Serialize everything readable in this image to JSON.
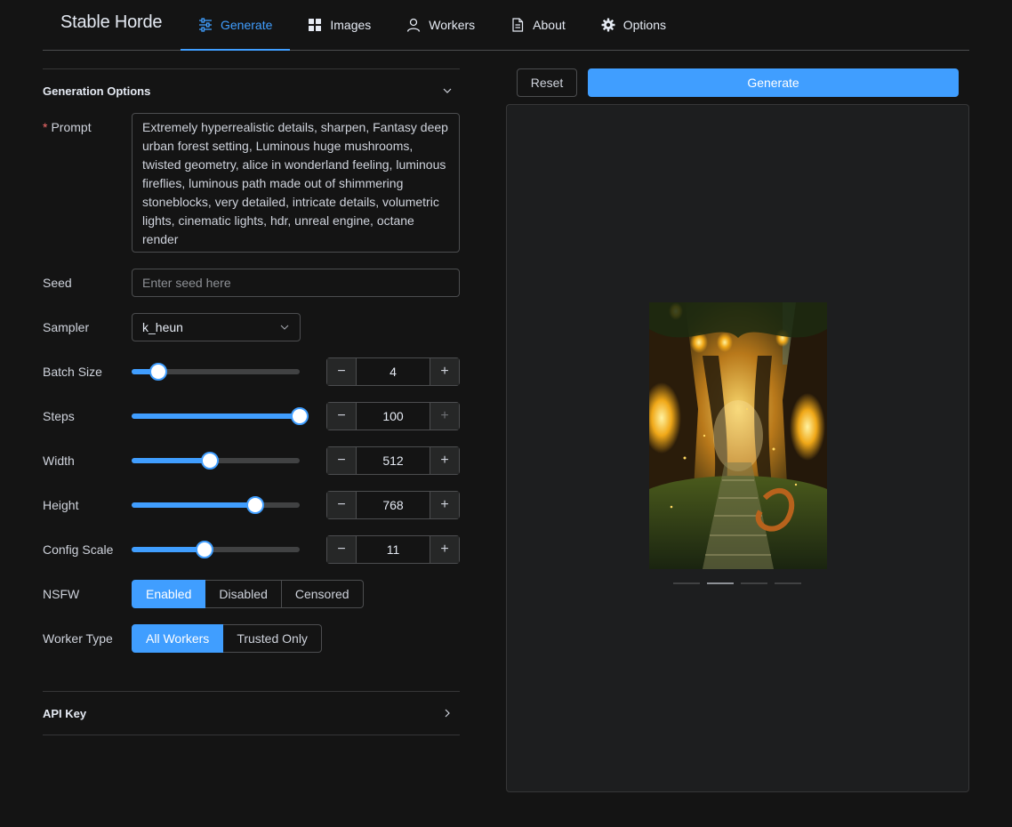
{
  "header": {
    "brand": "Stable Horde",
    "nav": [
      {
        "label": "Generate",
        "icon": "sliders-icon",
        "active": true
      },
      {
        "label": "Images",
        "icon": "grid-icon",
        "active": false
      },
      {
        "label": "Workers",
        "icon": "user-icon",
        "active": false
      },
      {
        "label": "About",
        "icon": "document-icon",
        "active": false
      },
      {
        "label": "Options",
        "icon": "gear-icon",
        "active": false
      }
    ]
  },
  "options": {
    "section_title": "Generation Options",
    "prompt": {
      "label": "Prompt",
      "required_mark": "*",
      "value": "Extremely hyperrealistic details, sharpen, Fantasy deep urban forest setting, Luminous huge mushrooms, twisted geometry, alice in wonderland feeling, luminous fireflies, luminous path made out of shimmering stoneblocks, very detailed, intricate details, volumetric lights, cinematic lights, hdr, unreal engine, octane render"
    },
    "seed": {
      "label": "Seed",
      "placeholder": "Enter seed here",
      "value": ""
    },
    "sampler": {
      "label": "Sampler",
      "value": "k_heun"
    },
    "batch_size": {
      "label": "Batch Size",
      "value": "4",
      "min": 1,
      "max": 20,
      "level": 4
    },
    "steps": {
      "label": "Steps",
      "value": "100",
      "min": 1,
      "max": 100,
      "level": 100
    },
    "width": {
      "label": "Width",
      "value": "512",
      "min": 64,
      "max": 1024,
      "level": 512
    },
    "height": {
      "label": "Height",
      "value": "768",
      "min": 64,
      "max": 1024,
      "level": 768
    },
    "config_scale": {
      "label": "Config Scale",
      "value": "11",
      "min": 1,
      "max": 24,
      "level": 11
    },
    "nsfw": {
      "label": "NSFW",
      "options": [
        "Enabled",
        "Disabled",
        "Censored"
      ],
      "selected": 0
    },
    "worker_type": {
      "label": "Worker Type",
      "options": [
        "All Workers",
        "Trusted Only"
      ],
      "selected": 0
    },
    "api_key_title": "API Key"
  },
  "actions": {
    "reset_label": "Reset",
    "generate_label": "Generate"
  },
  "preview": {
    "images_count": 4,
    "current_index": 1
  },
  "colors": {
    "accent": "#409eff",
    "background": "#141414",
    "panel": "#1d1e1f"
  }
}
